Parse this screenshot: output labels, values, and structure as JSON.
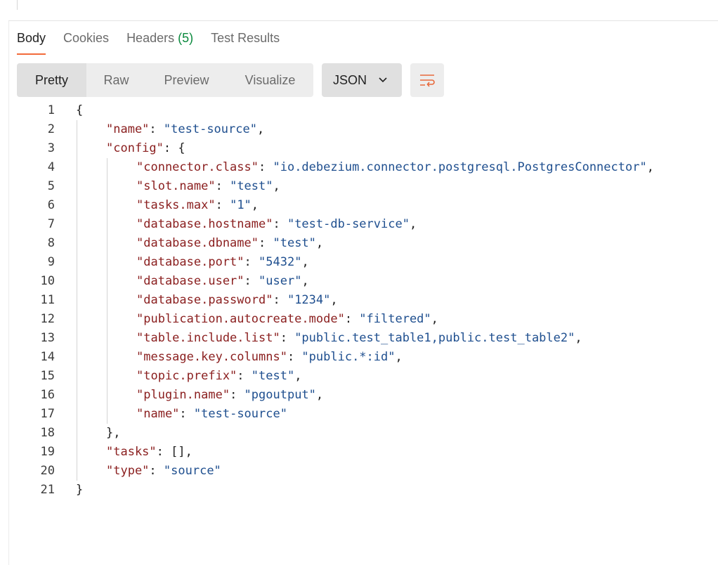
{
  "tabs": [
    {
      "label": "Body"
    },
    {
      "label": "Cookies"
    },
    {
      "label": "Headers ",
      "count": "(5)"
    },
    {
      "label": "Test Results"
    }
  ],
  "view_modes": [
    "Pretty",
    "Raw",
    "Preview",
    "Visualize"
  ],
  "language": "JSON",
  "icons": {
    "chevron": "chevron-down-icon",
    "wrap": "wrap-lines-icon"
  },
  "colors": {
    "accent": "#f26b3a",
    "key": "#8b2020",
    "string": "#1f4f8f",
    "count": "#0b8a3e"
  },
  "code": {
    "lines": [
      {
        "n": "1",
        "indent": 0,
        "parts": [
          {
            "t": "p",
            "v": "{"
          }
        ]
      },
      {
        "n": "2",
        "indent": 1,
        "parts": [
          {
            "t": "k",
            "v": "\"name\""
          },
          {
            "t": "p",
            "v": ": "
          },
          {
            "t": "s",
            "v": "\"test-source\""
          },
          {
            "t": "p",
            "v": ","
          }
        ]
      },
      {
        "n": "3",
        "indent": 1,
        "parts": [
          {
            "t": "k",
            "v": "\"config\""
          },
          {
            "t": "p",
            "v": ": {"
          }
        ]
      },
      {
        "n": "4",
        "indent": 2,
        "parts": [
          {
            "t": "k",
            "v": "\"connector.class\""
          },
          {
            "t": "p",
            "v": ": "
          },
          {
            "t": "s",
            "v": "\"io.debezium.connector.postgresql.PostgresConnector\""
          },
          {
            "t": "p",
            "v": ","
          }
        ]
      },
      {
        "n": "5",
        "indent": 2,
        "parts": [
          {
            "t": "k",
            "v": "\"slot.name\""
          },
          {
            "t": "p",
            "v": ": "
          },
          {
            "t": "s",
            "v": "\"test\""
          },
          {
            "t": "p",
            "v": ","
          }
        ]
      },
      {
        "n": "6",
        "indent": 2,
        "parts": [
          {
            "t": "k",
            "v": "\"tasks.max\""
          },
          {
            "t": "p",
            "v": ": "
          },
          {
            "t": "s",
            "v": "\"1\""
          },
          {
            "t": "p",
            "v": ","
          }
        ]
      },
      {
        "n": "7",
        "indent": 2,
        "parts": [
          {
            "t": "k",
            "v": "\"database.hostname\""
          },
          {
            "t": "p",
            "v": ": "
          },
          {
            "t": "s",
            "v": "\"test-db-service\""
          },
          {
            "t": "p",
            "v": ","
          }
        ]
      },
      {
        "n": "8",
        "indent": 2,
        "parts": [
          {
            "t": "k",
            "v": "\"database.dbname\""
          },
          {
            "t": "p",
            "v": ": "
          },
          {
            "t": "s",
            "v": "\"test\""
          },
          {
            "t": "p",
            "v": ","
          }
        ]
      },
      {
        "n": "9",
        "indent": 2,
        "parts": [
          {
            "t": "k",
            "v": "\"database.port\""
          },
          {
            "t": "p",
            "v": ": "
          },
          {
            "t": "s",
            "v": "\"5432\""
          },
          {
            "t": "p",
            "v": ","
          }
        ]
      },
      {
        "n": "10",
        "indent": 2,
        "parts": [
          {
            "t": "k",
            "v": "\"database.user\""
          },
          {
            "t": "p",
            "v": ": "
          },
          {
            "t": "s",
            "v": "\"user\""
          },
          {
            "t": "p",
            "v": ","
          }
        ]
      },
      {
        "n": "11",
        "indent": 2,
        "parts": [
          {
            "t": "k",
            "v": "\"database.password\""
          },
          {
            "t": "p",
            "v": ": "
          },
          {
            "t": "s",
            "v": "\"1234\""
          },
          {
            "t": "p",
            "v": ","
          }
        ]
      },
      {
        "n": "12",
        "indent": 2,
        "parts": [
          {
            "t": "k",
            "v": "\"publication.autocreate.mode\""
          },
          {
            "t": "p",
            "v": ": "
          },
          {
            "t": "s",
            "v": "\"filtered\""
          },
          {
            "t": "p",
            "v": ","
          }
        ]
      },
      {
        "n": "13",
        "indent": 2,
        "parts": [
          {
            "t": "k",
            "v": "\"table.include.list\""
          },
          {
            "t": "p",
            "v": ": "
          },
          {
            "t": "s",
            "v": "\"public.test_table1,public.test_table2\""
          },
          {
            "t": "p",
            "v": ","
          }
        ]
      },
      {
        "n": "14",
        "indent": 2,
        "parts": [
          {
            "t": "k",
            "v": "\"message.key.columns\""
          },
          {
            "t": "p",
            "v": ": "
          },
          {
            "t": "s",
            "v": "\"public.*:id\""
          },
          {
            "t": "p",
            "v": ","
          }
        ]
      },
      {
        "n": "15",
        "indent": 2,
        "parts": [
          {
            "t": "k",
            "v": "\"topic.prefix\""
          },
          {
            "t": "p",
            "v": ": "
          },
          {
            "t": "s",
            "v": "\"test\""
          },
          {
            "t": "p",
            "v": ","
          }
        ]
      },
      {
        "n": "16",
        "indent": 2,
        "parts": [
          {
            "t": "k",
            "v": "\"plugin.name\""
          },
          {
            "t": "p",
            "v": ": "
          },
          {
            "t": "s",
            "v": "\"pgoutput\""
          },
          {
            "t": "p",
            "v": ","
          }
        ]
      },
      {
        "n": "17",
        "indent": 2,
        "parts": [
          {
            "t": "k",
            "v": "\"name\""
          },
          {
            "t": "p",
            "v": ": "
          },
          {
            "t": "s",
            "v": "\"test-source\""
          }
        ]
      },
      {
        "n": "18",
        "indent": 1,
        "parts": [
          {
            "t": "p",
            "v": "},"
          }
        ]
      },
      {
        "n": "19",
        "indent": 1,
        "parts": [
          {
            "t": "k",
            "v": "\"tasks\""
          },
          {
            "t": "p",
            "v": ": [],"
          }
        ]
      },
      {
        "n": "20",
        "indent": 1,
        "parts": [
          {
            "t": "k",
            "v": "\"type\""
          },
          {
            "t": "p",
            "v": ": "
          },
          {
            "t": "s",
            "v": "\"source\""
          }
        ]
      },
      {
        "n": "21",
        "indent": 0,
        "parts": [
          {
            "t": "p",
            "v": "}"
          }
        ]
      }
    ]
  }
}
